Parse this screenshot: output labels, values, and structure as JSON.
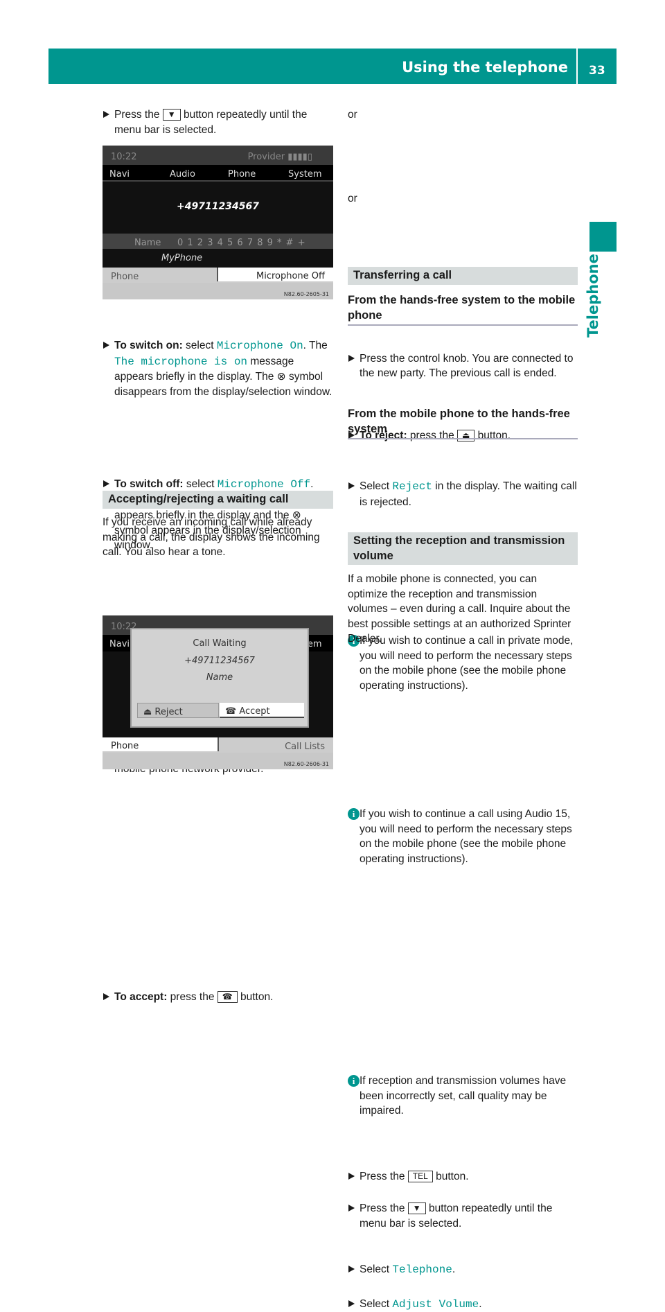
{
  "header": {
    "title": "Using the telephone",
    "page": "33",
    "side_tab": "Telephone",
    "accent": "#00968f"
  },
  "left": [
    {
      "type": "bullet",
      "seg": [
        [
          "n",
          "Press the "
        ],
        [
          "k",
          "▼"
        ],
        [
          "n",
          " button repeatedly until the menu bar is selected."
        ]
      ]
    },
    {
      "type": "screen1"
    },
    {
      "type": "bullet",
      "seg": [
        [
          "b",
          "To switch on:"
        ],
        [
          "n",
          " select "
        ],
        [
          "m",
          "Microphone On"
        ],
        [
          "n",
          ". The "
        ],
        [
          "m",
          "The microphone is on"
        ],
        [
          "n",
          " message appears briefly in the display. The "
        ],
        [
          "i",
          "⊗"
        ],
        [
          "n",
          " symbol disappears from the display/selection window."
        ]
      ]
    },
    {
      "type": "bullet",
      "seg": [
        [
          "b",
          "To switch off:"
        ],
        [
          "n",
          " select "
        ],
        [
          "m",
          "Microphone Off"
        ],
        [
          "n",
          ". The "
        ],
        [
          "m",
          "The microphone is off"
        ],
        [
          "n",
          " message appears briefly in the display and the "
        ],
        [
          "i",
          "⊗"
        ],
        [
          "n",
          " symbol appears in the display/selection window."
        ]
      ]
    },
    {
      "type": "section",
      "seg": [
        [
          "n",
          "Accepting/rejecting a waiting call"
        ]
      ]
    },
    {
      "type": "para",
      "seg": [
        [
          "n",
          "If you receive an incoming call while already making a call, the display shows the incoming call. You also hear a tone."
        ]
      ]
    },
    {
      "type": "info",
      "seg": [
        [
          "n",
          "The "
        ],
        [
          "b",
          "call waiting"
        ],
        [
          "n",
          " function is only available if it is supported and has been activated by the mobile phone network provider."
        ]
      ]
    },
    {
      "type": "screen2"
    },
    {
      "type": "bullet",
      "seg": [
        [
          "b",
          "To accept:"
        ],
        [
          "n",
          " press the "
        ],
        [
          "k",
          "☎"
        ],
        [
          "n",
          " button."
        ]
      ]
    }
  ],
  "right": [
    {
      "type": "para",
      "seg": [
        [
          "n",
          "or"
        ]
      ]
    },
    {
      "type": "bullet",
      "seg": [
        [
          "n",
          "Press the control knob. You are connected to the new party. The previous call is ended."
        ]
      ]
    },
    {
      "type": "bullet",
      "seg": [
        [
          "b",
          "To reject:"
        ],
        [
          "n",
          " press the "
        ],
        [
          "k",
          "⏏"
        ],
        [
          "n",
          " button."
        ]
      ]
    },
    {
      "type": "para",
      "seg": [
        [
          "n",
          "or"
        ]
      ]
    },
    {
      "type": "bullet",
      "seg": [
        [
          "n",
          "Select "
        ],
        [
          "m",
          "Reject"
        ],
        [
          "n",
          " in the display. The waiting call is rejected."
        ]
      ]
    },
    {
      "type": "section",
      "seg": [
        [
          "n",
          "Transferring a call"
        ]
      ]
    },
    {
      "type": "sub",
      "seg": [
        [
          "n",
          "From the hands-free system to the mobile phone"
        ]
      ]
    },
    {
      "type": "info",
      "seg": [
        [
          "n",
          "If you wish to continue a call in private mode, you will need to perform the necessary steps on the mobile phone (see the mobile phone operating instructions)."
        ]
      ]
    },
    {
      "type": "sub",
      "seg": [
        [
          "n",
          "From the mobile phone to the hands-free system"
        ]
      ]
    },
    {
      "type": "info",
      "seg": [
        [
          "n",
          "If you wish to continue a call using Audio 15, you will need to perform the necessary steps on the mobile phone (see the mobile phone operating instructions)."
        ]
      ]
    },
    {
      "type": "section",
      "seg": [
        [
          "n",
          "Setting the reception and transmission volume"
        ]
      ]
    },
    {
      "type": "para",
      "seg": [
        [
          "n",
          "If a mobile phone is connected, you can optimize the reception and transmission volumes – even during a call. Inquire about the best possible settings at an authorized Sprinter Dealer."
        ]
      ]
    },
    {
      "type": "info",
      "seg": [
        [
          "n",
          "If reception and transmission volumes have been incorrectly set, call quality may be impaired."
        ]
      ]
    },
    {
      "type": "bullet",
      "seg": [
        [
          "n",
          "Press the "
        ],
        [
          "k",
          "TEL"
        ],
        [
          "n",
          " button."
        ]
      ]
    },
    {
      "type": "bullet",
      "seg": [
        [
          "n",
          "Press the "
        ],
        [
          "k",
          "▼"
        ],
        [
          "n",
          " button repeatedly until the menu bar is selected."
        ]
      ]
    },
    {
      "type": "bullet",
      "seg": [
        [
          "n",
          "Select "
        ],
        [
          "m",
          "Telephone"
        ],
        [
          "n",
          "."
        ]
      ]
    },
    {
      "type": "bullet",
      "seg": [
        [
          "n",
          "Select "
        ],
        [
          "m",
          "Adjust Volume"
        ],
        [
          "n",
          "."
        ]
      ]
    }
  ],
  "screen1": {
    "time": "10:22",
    "provider": "Provider ▮▮▮▮▯",
    "menu": [
      "Navi",
      "Audio",
      "Phone",
      "System"
    ],
    "number": "+49711234567",
    "name_label": "Name",
    "digits": "0 1 2 3 4 5 6 7 8 9 * # +",
    "device": "MyPhone",
    "bottom_left": "Phone",
    "bottom_right": "Microphone Off",
    "code": "N82.60-2605-31"
  },
  "screen2": {
    "time": "10:22",
    "nav": "Navi",
    "sys": "System",
    "title": "Call Waiting",
    "number": "+49711234567",
    "name": "Name",
    "reject": "Reject",
    "accept": "Accept",
    "bottom_left": "Phone",
    "bottom_right": "Call Lists",
    "code": "N82.60-2606-31"
  }
}
